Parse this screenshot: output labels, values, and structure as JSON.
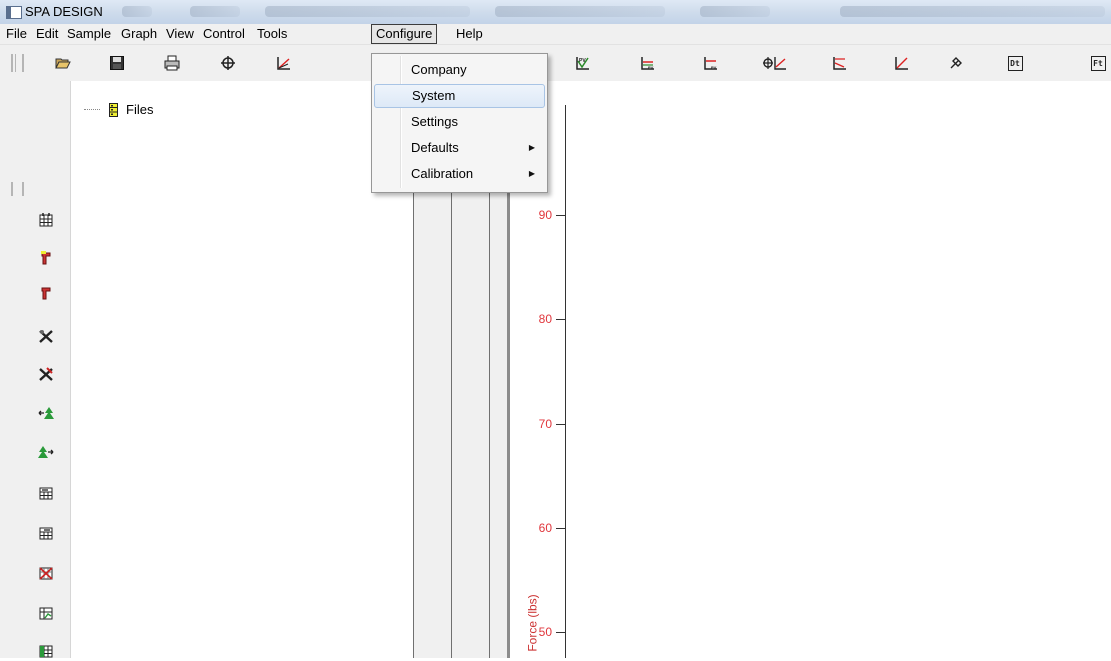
{
  "title": {
    "text": "SPA DESIGN"
  },
  "menu": [
    "File",
    "Edit",
    "Sample",
    "Graph",
    "View",
    "Control",
    "Tools",
    "Configure",
    "Help"
  ],
  "dropdown": [
    {
      "label": "Company"
    },
    {
      "label": "System",
      "highlighted": true
    },
    {
      "label": "Settings"
    },
    {
      "label": "Defaults",
      "submenu": true
    },
    {
      "label": "Calibration",
      "submenu": true
    }
  ],
  "toolbar_icons": [
    "open-folder",
    "save",
    "print",
    "crosshair-graph",
    "angle-graph",
    "pv-graph",
    "peak-graph",
    "peak-graph-2",
    "dual-graph",
    "trend-graph",
    "trend-graph-2",
    "tool",
    "dt",
    "ft"
  ],
  "toolbar_text": {
    "dt": "Dt",
    "ft": "Ft"
  },
  "vtoolbar_icons": [
    "table",
    "probe-add",
    "probe",
    "tools-cross",
    "tools-cross-red",
    "tree-left",
    "tree-right",
    "table-left",
    "table-right",
    "table-delete",
    "table-chart",
    "table-green"
  ],
  "tree": {
    "root": "Files"
  },
  "graph": {
    "ylabel": "Force (lbs)",
    "yticks": [
      "90",
      "80",
      "70",
      "60",
      "50"
    ],
    "axis_color": "#e0363c"
  }
}
